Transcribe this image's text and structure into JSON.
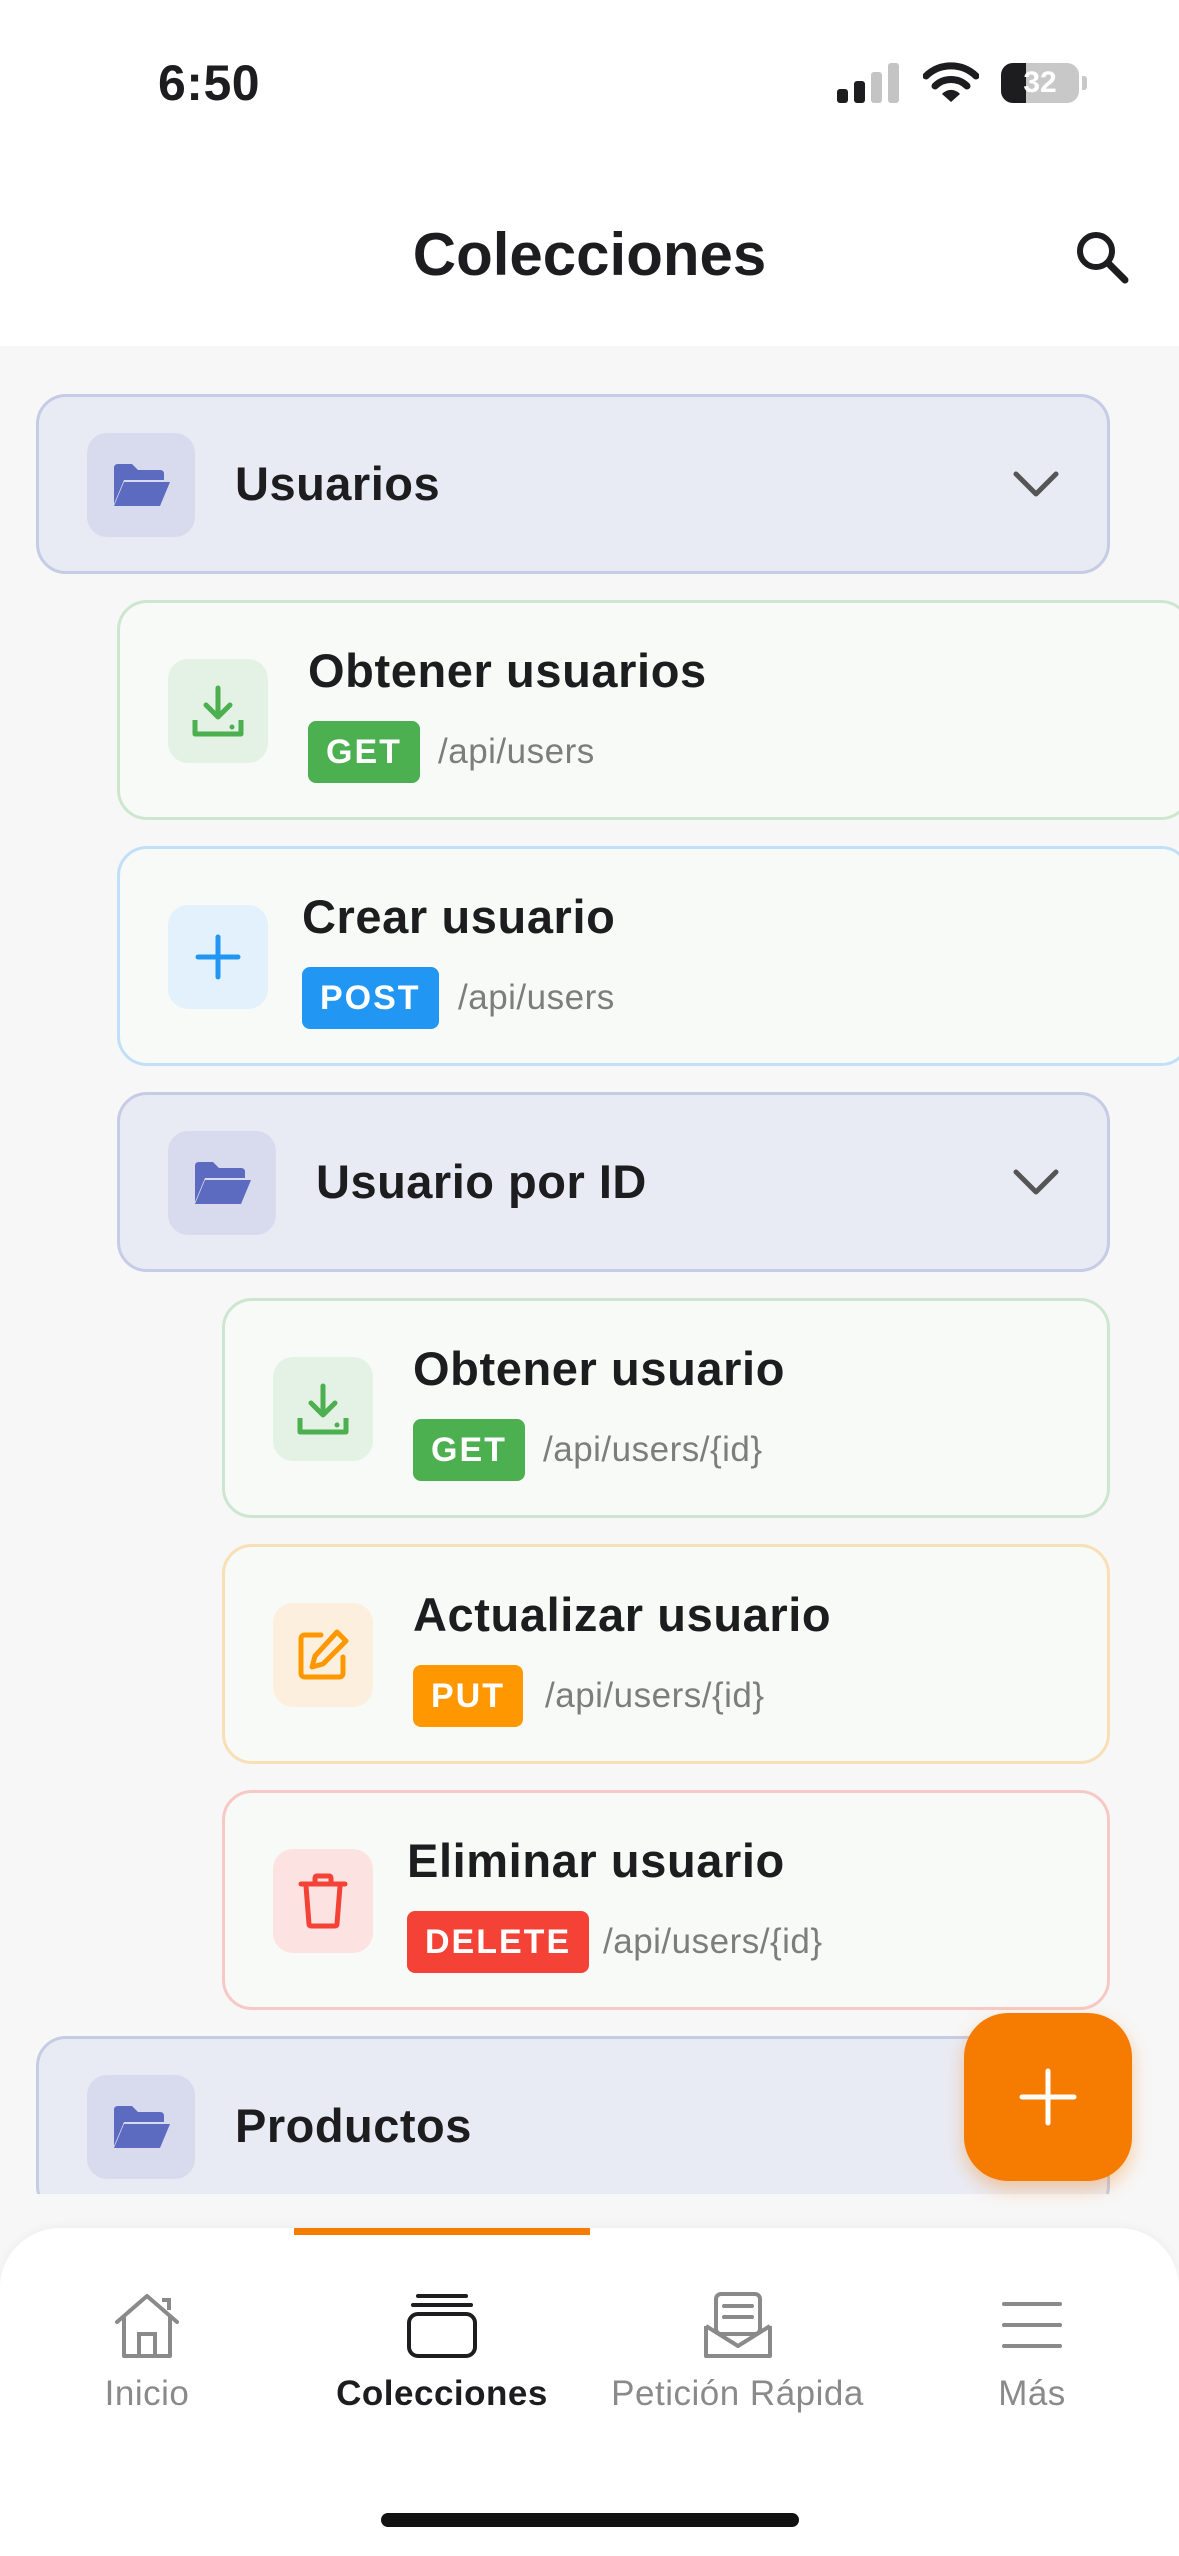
{
  "status_bar": {
    "time": "6:50",
    "battery": "32"
  },
  "header": {
    "title": "Colecciones"
  },
  "collections": [
    {
      "name": "Usuarios",
      "requests": [
        {
          "title": "Obtener usuarios",
          "method": "GET",
          "path": "/api/users"
        },
        {
          "title": "Crear usuario",
          "method": "POST",
          "path": "/api/users"
        }
      ],
      "subfolders": [
        {
          "name": "Usuario por ID",
          "requests": [
            {
              "title": "Obtener usuario",
              "method": "GET",
              "path": "/api/users/{id}"
            },
            {
              "title": "Actualizar usuario",
              "method": "PUT",
              "path": "/api/users/{id}"
            },
            {
              "title": "Eliminar usuario",
              "method": "DELETE",
              "path": "/api/users/{id}"
            }
          ]
        }
      ]
    },
    {
      "name": "Productos"
    }
  ],
  "method_colors": {
    "GET": "#4caf50",
    "POST": "#2196f3",
    "PUT": "#ff9800",
    "DELETE": "#f44336",
    "accent": "#f57c00",
    "folder": "#5c6bc0"
  },
  "nav": [
    {
      "label": "Inicio",
      "icon": "home-icon"
    },
    {
      "label": "Colecciones",
      "icon": "collections-icon",
      "active": true
    },
    {
      "label": "Petición Rápida",
      "icon": "quick-request-icon"
    },
    {
      "label": "Más",
      "icon": "menu-icon"
    }
  ]
}
